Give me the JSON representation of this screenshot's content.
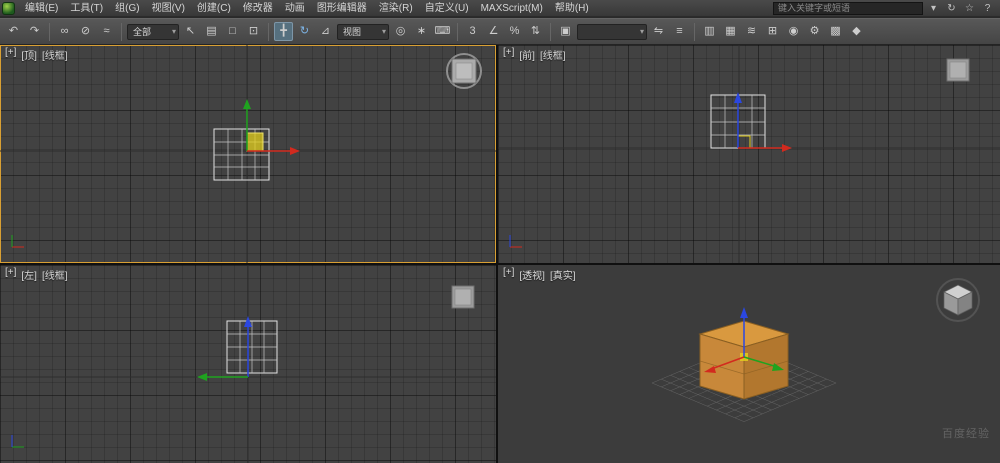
{
  "app": {
    "name": "3ds Max"
  },
  "menubar": {
    "items": [
      {
        "id": "edit",
        "label": "编辑(E)"
      },
      {
        "id": "tools",
        "label": "工具(T)"
      },
      {
        "id": "group",
        "label": "组(G)"
      },
      {
        "id": "views",
        "label": "视图(V)"
      },
      {
        "id": "create",
        "label": "创建(C)"
      },
      {
        "id": "modifiers",
        "label": "修改器"
      },
      {
        "id": "animation",
        "label": "动画"
      },
      {
        "id": "graph-editors",
        "label": "图形编辑器"
      },
      {
        "id": "rendering",
        "label": "渲染(R)"
      },
      {
        "id": "customize",
        "label": "自定义(U)"
      },
      {
        "id": "maxscript",
        "label": "MAXScript(M)"
      },
      {
        "id": "help",
        "label": "帮助(H)"
      }
    ]
  },
  "infocenter": {
    "placeholder": "键入关键字或短语",
    "icons": [
      {
        "name": "search-dropdown-arrow",
        "glyph": "▾"
      },
      {
        "name": "communication-center",
        "glyph": "↻"
      },
      {
        "name": "favorites-star",
        "glyph": "☆"
      },
      {
        "name": "help-question",
        "glyph": "?"
      }
    ]
  },
  "toolbar": {
    "items": [
      {
        "type": "button",
        "name": "undo",
        "glyph": "↶"
      },
      {
        "type": "button",
        "name": "redo",
        "glyph": "↷"
      },
      {
        "type": "divider"
      },
      {
        "type": "button",
        "name": "select-and-link",
        "glyph": "∞"
      },
      {
        "type": "button",
        "name": "unlink-selection",
        "glyph": "⊘"
      },
      {
        "type": "button",
        "name": "bind-to-space-warp",
        "glyph": "≈"
      },
      {
        "type": "divider"
      },
      {
        "type": "select",
        "name": "selection-filter-select",
        "value": "全部"
      },
      {
        "type": "button",
        "name": "select-object",
        "glyph": "↖"
      },
      {
        "type": "button",
        "name": "select-by-name",
        "glyph": "▤"
      },
      {
        "type": "button",
        "name": "rectangular-selection-region",
        "glyph": "□"
      },
      {
        "type": "button",
        "name": "window-crossing-toggle",
        "glyph": "⊡"
      },
      {
        "type": "divider"
      },
      {
        "type": "button",
        "name": "select-and-move",
        "glyph": "╋",
        "active": true
      },
      {
        "type": "button",
        "name": "select-and-rotate",
        "glyph": "↻",
        "color": "#7db5e8"
      },
      {
        "type": "button",
        "name": "select-and-scale",
        "glyph": "⊿"
      },
      {
        "type": "select",
        "name": "reference-coordinate-system-select",
        "value": "视图"
      },
      {
        "type": "button",
        "name": "use-pivot-point-center",
        "glyph": "◎"
      },
      {
        "type": "button",
        "name": "select-and-manipulate",
        "glyph": "∗"
      },
      {
        "type": "button",
        "name": "keyboard-shortcut-override",
        "glyph": "⌨"
      },
      {
        "type": "divider"
      },
      {
        "type": "button",
        "name": "snaps-toggle-3d",
        "glyph": "3"
      },
      {
        "type": "button",
        "name": "angle-snap-toggle",
        "glyph": "∠"
      },
      {
        "type": "button",
        "name": "percent-snap-toggle",
        "glyph": "%"
      },
      {
        "type": "button",
        "name": "spinner-snap-toggle",
        "glyph": "⇅"
      },
      {
        "type": "divider"
      },
      {
        "type": "button",
        "name": "edit-named-selection-sets",
        "glyph": "▣"
      },
      {
        "type": "combo",
        "name": "named-selection-combo",
        "value": ""
      },
      {
        "type": "button",
        "name": "mirror",
        "glyph": "⇋"
      },
      {
        "type": "button",
        "name": "align",
        "glyph": "≡"
      },
      {
        "type": "divider"
      },
      {
        "type": "button",
        "name": "layer-manager",
        "glyph": "▥"
      },
      {
        "type": "button",
        "name": "graphite-modeling-ribbon",
        "glyph": "▦"
      },
      {
        "type": "button",
        "name": "curve-editor",
        "glyph": "≋"
      },
      {
        "type": "button",
        "name": "schematic-view",
        "glyph": "⊞"
      },
      {
        "type": "button",
        "name": "material-editor",
        "glyph": "◉"
      },
      {
        "type": "button",
        "name": "render-setup",
        "glyph": "⚙"
      },
      {
        "type": "button",
        "name": "rendered-frame-window",
        "glyph": "▩"
      },
      {
        "type": "button",
        "name": "render-production",
        "glyph": "◆"
      }
    ]
  },
  "viewports": {
    "top": {
      "plus": "[+]",
      "name": "[顶]",
      "shading": "[线框]"
    },
    "front": {
      "plus": "[+]",
      "name": "[前]",
      "shading": "[线框]"
    },
    "left": {
      "plus": "[+]",
      "name": "[左]",
      "shading": "[线框]"
    },
    "perspective": {
      "plus": "[+]",
      "name": "[透视]",
      "shading": "[真实]"
    }
  },
  "watermark": "百度经验",
  "colors": {
    "axis_x": "#d22a1e",
    "axis_y": "#1fa31f",
    "axis_z": "#2b47e0",
    "plane_handle": "#e3cf1d",
    "active_border": "#d9a033",
    "wire": "#e3e3e3",
    "box_top": "#d9993f",
    "box_front": "#c8883a",
    "box_right": "#b2772e",
    "box_edge": "#8a5f22"
  }
}
